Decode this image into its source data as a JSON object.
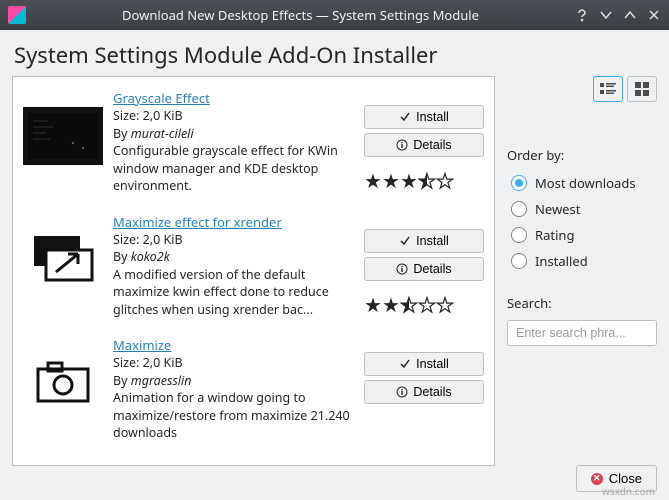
{
  "window": {
    "title": "Download New Desktop Effects — System Settings Module"
  },
  "page": {
    "heading": "System Settings Module Add-On Installer"
  },
  "buttons": {
    "install": "Install",
    "details": "Details",
    "close": "Close"
  },
  "sidebar": {
    "order_label": "Order by:",
    "search_label": "Search:",
    "search_placeholder": "Enter search phra...",
    "options": {
      "most_downloads": "Most downloads",
      "newest": "Newest",
      "rating": "Rating",
      "installed": "Installed"
    },
    "selected": "most_downloads"
  },
  "items": [
    {
      "title": "Grayscale Effect",
      "size": "Size: 2,0 KiB",
      "author_prefix": "By ",
      "author": "murat-cileli",
      "desc": "Configurable grayscale effect for KWin window manager and KDE desktop environment.",
      "rating_full": 3,
      "rating_half": true
    },
    {
      "title": "Maximize effect for xrender",
      "size": "Size: 2,0 KiB",
      "author_prefix": "By ",
      "author": "koko2k",
      "desc": "A modified version of the default maximize kwin effect done to reduce glitches when using xrender bac...",
      "rating_full": 2,
      "rating_half": true
    },
    {
      "title": "Maximize",
      "size": "Size: 2,0 KiB",
      "author_prefix": "By ",
      "author": "mgraesslin",
      "desc": "Animation for a window going to maximize/restore from maximize 21.240 downloads",
      "rating_full": 0,
      "rating_half": false
    }
  ],
  "watermark": "wsxdn.com"
}
